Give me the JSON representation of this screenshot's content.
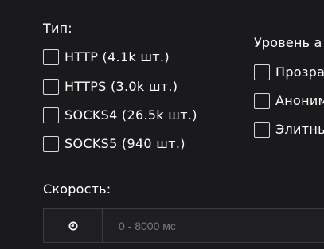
{
  "type_filter": {
    "title": "Тип:",
    "options": [
      {
        "label": "HTTP (4.1k шт.)",
        "checked": false
      },
      {
        "label": "HTTPS (3.0k шт.)",
        "checked": false
      },
      {
        "label": "SOCKS4 (26.5k шт.)",
        "checked": false
      },
      {
        "label": "SOCKS5 (940 шт.)",
        "checked": false
      }
    ]
  },
  "anonymity_filter": {
    "title": "Уровень а",
    "options": [
      {
        "label": "Прозра",
        "checked": false
      },
      {
        "label": "Аноним",
        "checked": false
      },
      {
        "label": "Элитны",
        "checked": false
      }
    ]
  },
  "speed_filter": {
    "title": "Скорость:",
    "icon": "clock-icon",
    "value": "",
    "placeholder": "0 - 8000 мс"
  }
}
